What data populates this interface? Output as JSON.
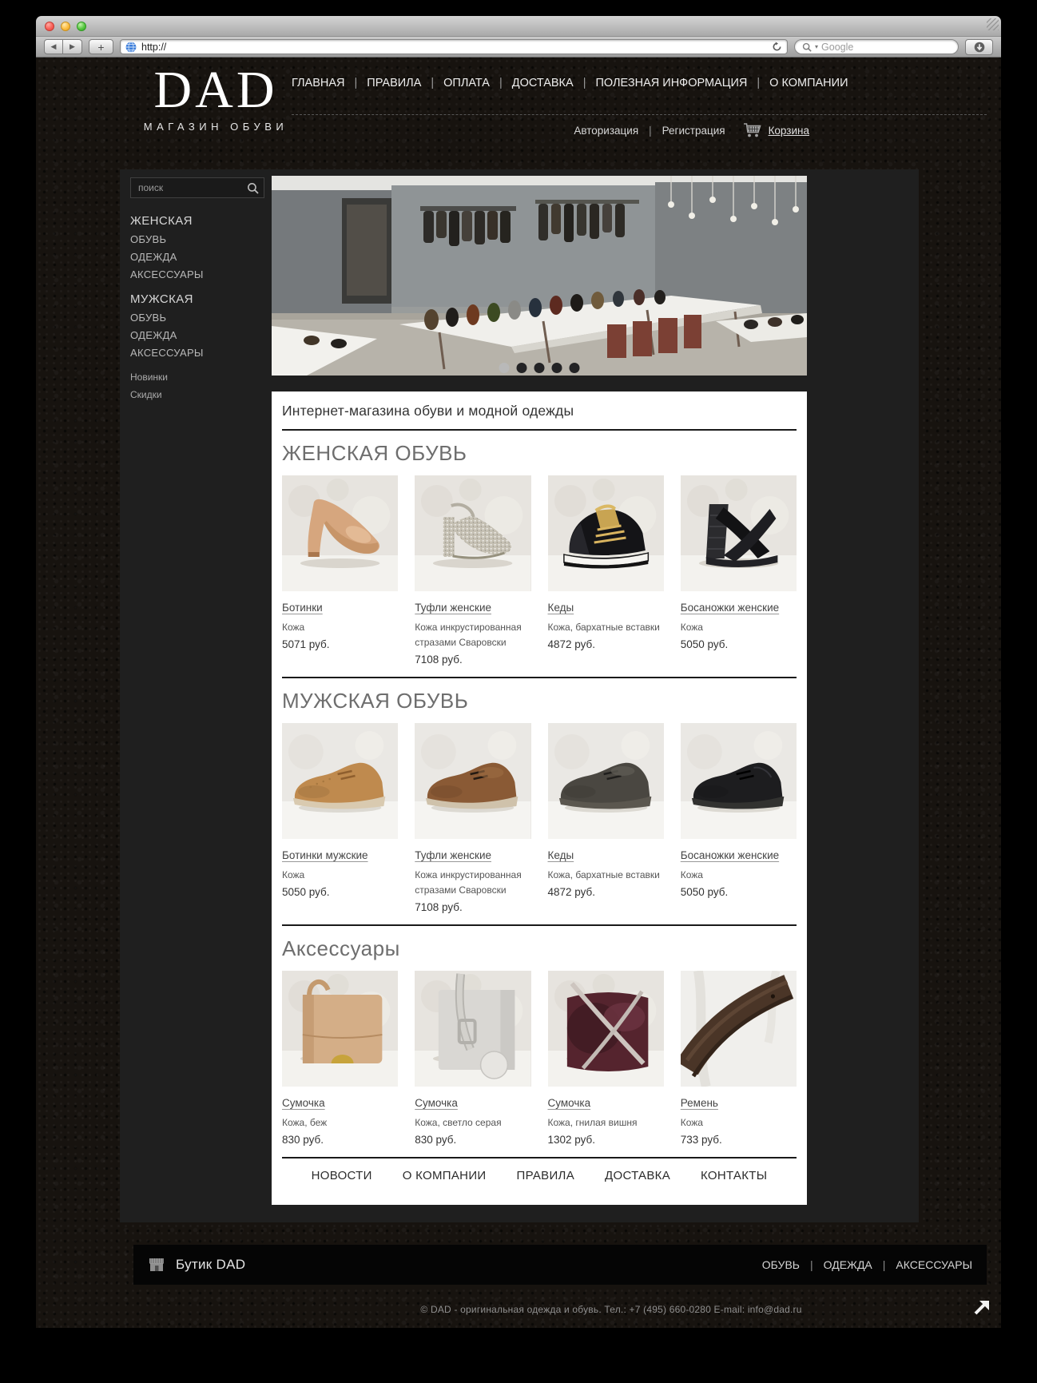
{
  "browser": {
    "url_value": "http://",
    "search_placeholder": "Google",
    "back_glyph": "◀",
    "forward_glyph": "▶",
    "new_tab_glyph": "+",
    "search_caret_glyph": "▾"
  },
  "header": {
    "logo": "DAD",
    "tagline": "МАГАЗИН ОБУВИ",
    "nav_items": [
      "ГЛАВНАЯ",
      "ПРАВИЛА",
      "ОПЛАТА",
      "ДОСТАВКА",
      "ПОЛЕЗНАЯ ИНФОРМАЦИЯ",
      "О КОМПАНИИ"
    ],
    "account_links": [
      "Авторизация",
      "Регистрация"
    ],
    "cart_label": "Корзина"
  },
  "sidebar": {
    "search_placeholder": "поиск",
    "groups": [
      {
        "title": "ЖЕНСКАЯ",
        "items": [
          "ОБУВЬ",
          "ОДЕЖДА",
          "АКСЕССУАРЫ"
        ]
      },
      {
        "title": "МУЖСКАЯ",
        "items": [
          "ОБУВЬ",
          "ОДЕЖДА",
          "АКСЕССУАРЫ"
        ]
      }
    ],
    "extra_links": [
      "Новинки",
      "Скидки"
    ]
  },
  "hero": {
    "image": "store-interior-photo",
    "dots_total": 5,
    "active_dot": 0
  },
  "main": {
    "headline": "Интернет-магазина обуви и модной одежды",
    "sections": [
      {
        "title": "ЖЕНСКАЯ ОБУВЬ",
        "products": [
          {
            "name": "Ботинки",
            "desc": "Кожа",
            "price": "5071 руб.",
            "image": "beige-pump-photo"
          },
          {
            "name": "Туфли женские",
            "desc": "Кожа инкрустированная стразами Сваровски",
            "price": "7108 руб.",
            "image": "glitter-heels-photo"
          },
          {
            "name": "Кеды",
            "desc": "Кожа, бархатные вставки",
            "price": "4872 руб.",
            "image": "black-gold-sneaker-photo"
          },
          {
            "name": "Босаножки женские",
            "desc": "Кожа",
            "price": "5050 руб.",
            "image": "black-wedge-sandal-photo"
          }
        ]
      },
      {
        "title": "МУЖСКАЯ ОБУВЬ",
        "products": [
          {
            "name": "Ботинки мужские",
            "desc": "Кожа",
            "price": "5050 руб.",
            "image": "tan-derby-photo"
          },
          {
            "name": "Туфли женские",
            "desc": "Кожа инкрустированная стразами Сваровски",
            "price": "7108 руб.",
            "image": "brown-suede-shoe-photo"
          },
          {
            "name": "Кеды",
            "desc": "Кожа, бархатные вставки",
            "price": "4872 руб.",
            "image": "dark-casual-shoe-photo"
          },
          {
            "name": "Босаножки женские",
            "desc": "Кожа",
            "price": "5050 руб.",
            "image": "black-derby-photo"
          }
        ]
      },
      {
        "title": "Аксессуары",
        "products": [
          {
            "name": "Сумочка",
            "desc": "Кожа, беж",
            "price": "830 руб.",
            "image": "beige-handbag-photo"
          },
          {
            "name": "Сумочка",
            "desc": "Кожа, светло серая",
            "price": "830 руб.",
            "image": "gray-handbag-photo"
          },
          {
            "name": "Сумочка",
            "desc": "Кожа, гнилая вишня",
            "price": "1302 руб.",
            "image": "cherry-handbag-photo"
          },
          {
            "name": "Ремень",
            "desc": "Кожа",
            "price": "733 руб.",
            "image": "brown-belt-photo"
          }
        ]
      }
    ],
    "footer_nav": [
      "НОВОСТИ",
      "О КОМПАНИИ",
      "ПРАВИЛА",
      "ДОСТАВКА",
      "КОНТАКТЫ"
    ]
  },
  "footer": {
    "shop_label": "Бутик DAD",
    "nav_items": [
      "ОБУВЬ",
      "ОДЕЖДА",
      "АКСЕССУАРЫ"
    ],
    "copyright": "© DAD - оригинальная одежда и обувь. Тел.: +7 (495) 660-0280 E-mail: info@dad.ru"
  },
  "colors": {
    "page_bg": "#17130f",
    "panel_bg": "#1f1f1f",
    "card_bg": "#ffffff",
    "footer_bar_bg": "#050505",
    "accent_gold": "#c8a452",
    "heading_gray": "#6e6e6e"
  }
}
